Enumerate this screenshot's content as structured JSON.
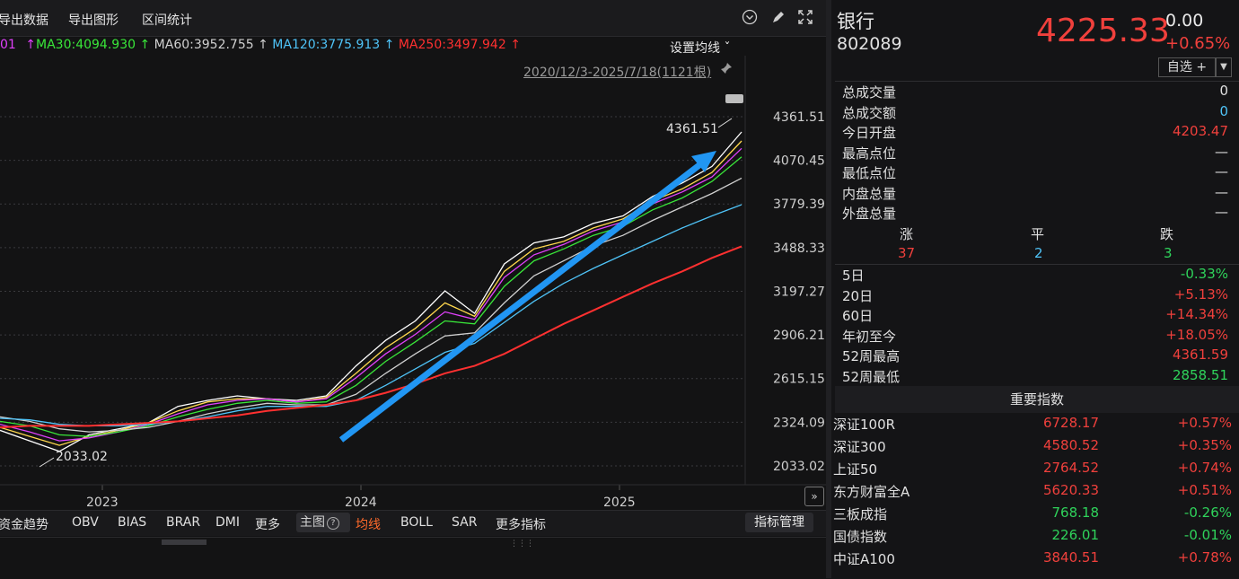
{
  "toolbar": {
    "export_data": "导出数据",
    "export_image": "导出图形",
    "range_stats": "区间统计"
  },
  "ma": {
    "prefix": "01",
    "ma30": "MA30:4094.930",
    "ma60": "MA60:3952.755",
    "ma120": "MA120:3775.913",
    "ma250": "MA250:3497.942",
    "arrow": "↑",
    "settings": "设置均线 ˇ",
    "colors": {
      "prefix": "#e040fb",
      "ma30": "#39e639",
      "ma60": "#d0d0d0",
      "ma120": "#4fc3f7",
      "ma250": "#ff3030"
    }
  },
  "range": {
    "label": "2020/12/3-2025/7/18(1121根)"
  },
  "chart_data": {
    "type": "line",
    "y_ticks": [
      "4361.51",
      "4070.45",
      "3779.39",
      "3488.33",
      "3197.27",
      "2906.21",
      "2615.15",
      "2324.09",
      "2033.02"
    ],
    "ylim": [
      2033.02,
      4361.51
    ],
    "x_ticks": [
      "2023",
      "2024",
      "2025"
    ],
    "high_label": "4361.51",
    "low_label": "2033.02",
    "x": [
      0,
      0.04,
      0.08,
      0.12,
      0.16,
      0.2,
      0.24,
      0.28,
      0.32,
      0.36,
      0.4,
      0.44,
      0.48,
      0.52,
      0.56,
      0.6,
      0.64,
      0.68,
      0.72,
      0.76,
      0.8,
      0.84,
      0.88,
      0.92,
      0.96,
      1.0
    ],
    "series": [
      {
        "values": [
          2270,
          2200,
          2130,
          2240,
          2280,
          2320,
          2430,
          2470,
          2500,
          2480,
          2470,
          2500,
          2700,
          2870,
          3000,
          3200,
          3050,
          3380,
          3520,
          3560,
          3650,
          3700,
          3830,
          3920,
          4030,
          4260
        ],
        "color": "#ffffff"
      },
      {
        "values": [
          2290,
          2230,
          2170,
          2230,
          2270,
          2320,
          2400,
          2460,
          2480,
          2480,
          2460,
          2490,
          2650,
          2820,
          2950,
          3120,
          3030,
          3330,
          3480,
          3530,
          3620,
          3680,
          3800,
          3880,
          3990,
          4200
        ],
        "color": "#ffd84d"
      },
      {
        "values": [
          2310,
          2260,
          2200,
          2220,
          2260,
          2310,
          2380,
          2440,
          2470,
          2480,
          2460,
          2480,
          2620,
          2780,
          2910,
          3060,
          3010,
          3290,
          3440,
          3510,
          3600,
          3660,
          3780,
          3860,
          3960,
          4150
        ],
        "color": "#e040fb"
      },
      {
        "values": [
          2330,
          2300,
          2240,
          2230,
          2260,
          2300,
          2360,
          2410,
          2450,
          2470,
          2450,
          2460,
          2570,
          2730,
          2860,
          3000,
          2980,
          3230,
          3400,
          3480,
          3570,
          3630,
          3740,
          3820,
          3930,
          4094
        ],
        "color": "#39e639"
      },
      {
        "values": [
          2360,
          2330,
          2280,
          2260,
          2270,
          2290,
          2330,
          2380,
          2420,
          2450,
          2440,
          2440,
          2510,
          2650,
          2780,
          2900,
          2920,
          3120,
          3300,
          3400,
          3500,
          3570,
          3670,
          3760,
          3850,
          3952
        ],
        "color": "#d0d0d0"
      },
      {
        "values": [
          2350,
          2340,
          2310,
          2300,
          2300,
          2310,
          2330,
          2360,
          2400,
          2430,
          2430,
          2430,
          2470,
          2570,
          2680,
          2790,
          2850,
          2990,
          3130,
          3250,
          3350,
          3440,
          3530,
          3620,
          3700,
          3775
        ],
        "color": "#4fc3f7"
      },
      {
        "values": [
          2290,
          2300,
          2300,
          2300,
          2310,
          2320,
          2330,
          2350,
          2370,
          2400,
          2420,
          2440,
          2470,
          2520,
          2580,
          2650,
          2700,
          2780,
          2880,
          2980,
          3070,
          3160,
          3250,
          3330,
          3420,
          3497
        ],
        "color": "#ff3030"
      }
    ]
  },
  "tabs": {
    "capital_trend": "资金趋势",
    "obv": "OBV",
    "bias": "BIAS",
    "brar": "BRAR",
    "dmi": "DMI",
    "more": "更多",
    "main_chart": "主图",
    "ma_line": "均线",
    "boll": "BOLL",
    "sar": "SAR",
    "more_indicators": "更多指标",
    "indicator_manager": "指标管理"
  },
  "quote": {
    "name": "银行",
    "code": "802089",
    "price": "4225.33",
    "change": "0.00",
    "pct": "+0.65%",
    "watchlist": "自选 +"
  },
  "stats": [
    {
      "k": "总成交量",
      "v": "0",
      "cls": "white"
    },
    {
      "k": "总成交额",
      "v": "0",
      "cls": "cyan"
    },
    {
      "k": "今日开盘",
      "v": "4203.47",
      "cls": "red"
    },
    {
      "k": "最高点位",
      "v": "—",
      "cls": "white"
    },
    {
      "k": "最低点位",
      "v": "—",
      "cls": "white"
    },
    {
      "k": "内盘总量",
      "v": "—",
      "cls": "white"
    },
    {
      "k": "外盘总量",
      "v": "—",
      "cls": "white"
    }
  ],
  "breadth": {
    "up_label": "涨",
    "flat_label": "平",
    "down_label": "跌",
    "up": "37",
    "flat": "2",
    "down": "3"
  },
  "perf": [
    {
      "k": "5日",
      "v": "-0.33%",
      "cls": "green"
    },
    {
      "k": "20日",
      "v": "+5.13%",
      "cls": "red"
    },
    {
      "k": "60日",
      "v": "+14.34%",
      "cls": "red"
    },
    {
      "k": "年初至今",
      "v": "+18.05%",
      "cls": "red"
    },
    {
      "k": "52周最高",
      "v": "4361.59",
      "cls": "red"
    },
    {
      "k": "52周最低",
      "v": "2858.51",
      "cls": "green"
    }
  ],
  "indices": {
    "title": "重要指数",
    "rows": [
      {
        "n": "深证100R",
        "p": "6728.17",
        "c": "+0.57%",
        "cls": "red"
      },
      {
        "n": "深证300",
        "p": "4580.52",
        "c": "+0.35%",
        "cls": "red"
      },
      {
        "n": "上证50",
        "p": "2764.52",
        "c": "+0.74%",
        "cls": "red"
      },
      {
        "n": "东方财富全A",
        "p": "5620.33",
        "c": "+0.51%",
        "cls": "red"
      },
      {
        "n": "三板成指",
        "p": "768.18",
        "c": "-0.26%",
        "cls": "green"
      },
      {
        "n": "国债指数",
        "p": "226.01",
        "c": "-0.01%",
        "cls": "green"
      },
      {
        "n": "中证A100",
        "p": "3840.51",
        "c": "+0.78%",
        "cls": "red"
      }
    ]
  }
}
